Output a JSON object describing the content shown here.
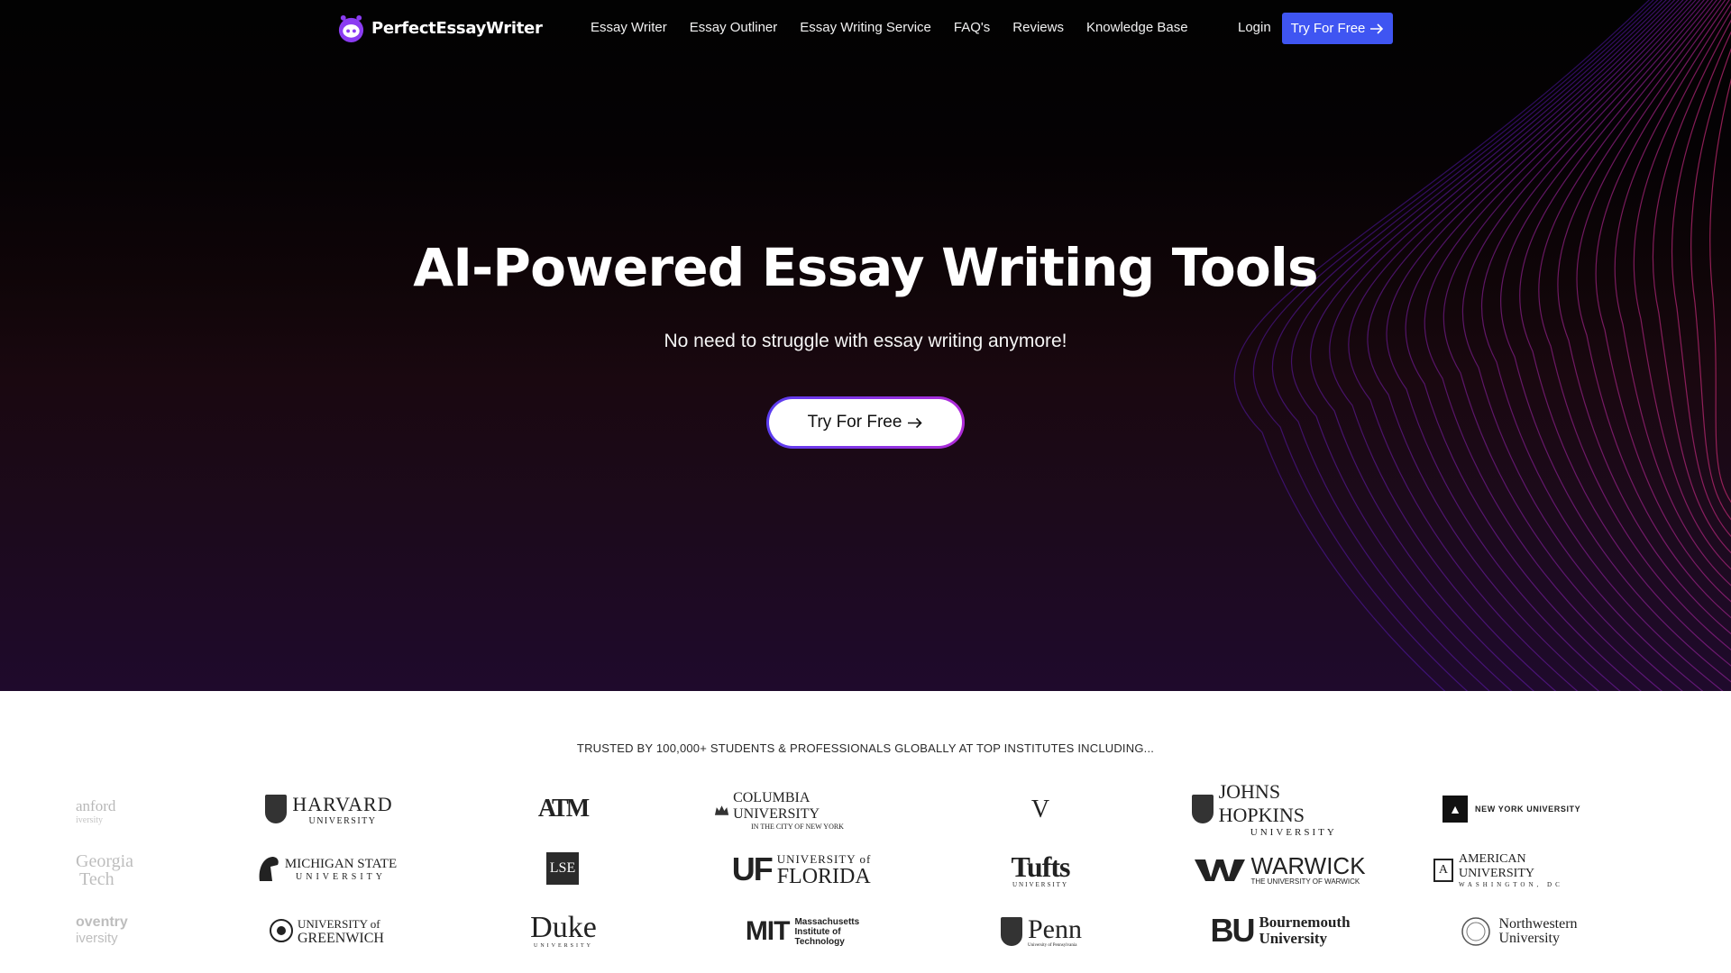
{
  "brand": {
    "name": "PerfectEssayWriter"
  },
  "nav": {
    "links": [
      "Essay Writer",
      "Essay Outliner",
      "Essay Writing Service",
      "FAQ's",
      "Reviews",
      "Knowledge Base"
    ],
    "login": "Login",
    "cta": "Try For Free"
  },
  "hero": {
    "title": "AI-Powered Essay Writing Tools",
    "subtitle": "No need to struggle with essay writing anymore!",
    "cta": "Try For Free"
  },
  "trusted": {
    "heading": "TRUSTED BY 100,000+ STUDENTS & PROFESSIONALS GLOBALLY AT TOP INSTITUTES INCLUDING..."
  },
  "institutions": {
    "stanford": {
      "line1": "anford",
      "line2": "iversity"
    },
    "harvard": {
      "line1": "HARVARD",
      "line2": "UNIVERSITY"
    },
    "tamu": {
      "text": "ATM"
    },
    "columbia": {
      "line1": "COLUMBIA UNIVERSITY",
      "line2": "IN THE CITY OF NEW YORK"
    },
    "virginia": {
      "text": "V"
    },
    "jhu": {
      "line1": "JOHNS HOPKINS",
      "line2": "UNIVERSITY"
    },
    "nyu": {
      "text": "NEW YORK UNIVERSITY"
    },
    "georgia": {
      "line1": "Georgia",
      "line2": "Tech"
    },
    "msu": {
      "line1": "MICHIGAN STATE",
      "line2": "UNIVERSITY"
    },
    "lse": {
      "text": "LSE"
    },
    "uf": {
      "mark": "UF",
      "line1": "UNIVERSITY of",
      "line2": "FLORIDA"
    },
    "tufts": {
      "line1": "Tufts",
      "line2": "UNIVERSITY"
    },
    "warwick": {
      "line1": "WARWICK",
      "line2": "THE UNIVERSITY OF WARWICK"
    },
    "american": {
      "line1": "AMERICAN UNIVERSITY",
      "line2": "WASHINGTON, DC"
    },
    "coventry": {
      "line1": "oventry",
      "line2": "iversity"
    },
    "greenwich": {
      "line1": "UNIVERSITY of",
      "line2": "GREENWICH"
    },
    "duke": {
      "line1": "Duke",
      "line2": "UNIVERSITY"
    },
    "mit": {
      "mark": "MIT",
      "line1": "Massachusetts",
      "line2": "Institute of",
      "line3": "Technology"
    },
    "penn": {
      "line1": "Penn",
      "line2": "University of Pennsylvania"
    },
    "bu": {
      "mark": "BU",
      "line1": "Bournemouth",
      "line2": "University"
    },
    "northwestern": {
      "line1": "Northwestern",
      "line2": "University"
    }
  },
  "icons": {
    "arrow": "arrow-right-icon",
    "logo": "robot-logo-icon"
  },
  "colors": {
    "accent": "#3f55f2",
    "cta_border_start": "#5a3df0",
    "cta_border_end": "#b02bd8",
    "wave": "#7a2fd0"
  }
}
